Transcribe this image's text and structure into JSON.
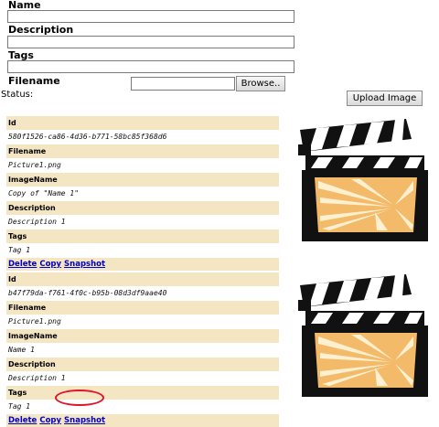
{
  "form": {
    "name_label": "Name",
    "description_label": "Description",
    "tags_label": "Tags",
    "filename_label": "Filename",
    "name_value": "",
    "description_value": "",
    "tags_value": "",
    "filename_value": "",
    "browse_label": "Browse..",
    "status_label": "Status:",
    "upload_label": "Upload Image"
  },
  "records": [
    {
      "id_label": "Id",
      "id": "580f1526-ca86-4d36-b771-58bc85f368d6",
      "filename_label": "Filename",
      "filename": "Picture1.png",
      "imagename_label": "ImageName",
      "imagename": "Copy of \"Name 1\"",
      "description_label": "Description",
      "description": "Description 1",
      "tags_label": "Tags",
      "tags": "Tag 1",
      "delete_label": "Delete",
      "copy_label": "Copy",
      "snapshot_label": "Snapshot"
    },
    {
      "id_label": "Id",
      "id": "b47f79da-f761-4f0c-b95b-08d3df9aae40",
      "filename_label": "Filename",
      "filename": "Picture1.png",
      "imagename_label": "ImageName",
      "imagename": "Name 1",
      "description_label": "Description",
      "description": "Description 1",
      "tags_label": "Tags",
      "tags": "Tag 1",
      "delete_label": "Delete",
      "copy_label": "Copy",
      "snapshot_label": "Snapshot"
    }
  ],
  "colors": {
    "label_band": "#f5e6c3",
    "link": "#0000cc",
    "highlight": "#e0162b"
  }
}
